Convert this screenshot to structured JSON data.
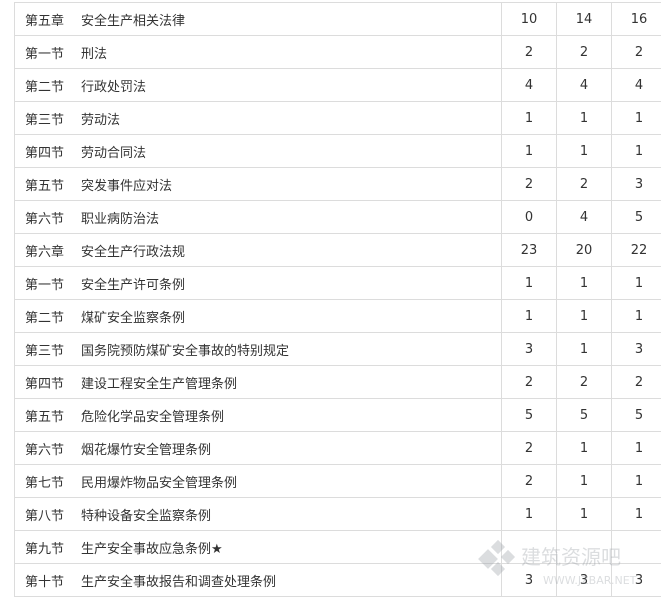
{
  "rows": [
    {
      "section": "第五章",
      "title": "安全生产相关法律",
      "counts": [
        "10",
        "14",
        "16"
      ]
    },
    {
      "section": "第一节",
      "title": "刑法",
      "counts": [
        "2",
        "2",
        "2"
      ]
    },
    {
      "section": "第二节",
      "title": "行政处罚法",
      "counts": [
        "4",
        "4",
        "4"
      ]
    },
    {
      "section": "第三节",
      "title": "劳动法",
      "counts": [
        "1",
        "1",
        "1"
      ]
    },
    {
      "section": "第四节",
      "title": "劳动合同法",
      "counts": [
        "1",
        "1",
        "1"
      ]
    },
    {
      "section": "第五节",
      "title": "突发事件应对法",
      "counts": [
        "2",
        "2",
        "3"
      ]
    },
    {
      "section": "第六节",
      "title": "职业病防治法",
      "counts": [
        "0",
        "4",
        "5"
      ]
    },
    {
      "section": "第六章",
      "title": "安全生产行政法规",
      "counts": [
        "23",
        "20",
        "22"
      ]
    },
    {
      "section": "第一节",
      "title": "安全生产许可条例",
      "counts": [
        "1",
        "1",
        "1"
      ]
    },
    {
      "section": "第二节",
      "title": "煤矿安全监察条例",
      "counts": [
        "1",
        "1",
        "1"
      ]
    },
    {
      "section": "第三节",
      "title": "国务院预防煤矿安全事故的特别规定",
      "counts": [
        "3",
        "1",
        "3"
      ]
    },
    {
      "section": "第四节",
      "title": "建设工程安全生产管理条例",
      "counts": [
        "2",
        "2",
        "2"
      ]
    },
    {
      "section": "第五节",
      "title": "危险化学品安全管理条例",
      "counts": [
        "5",
        "5",
        "5"
      ]
    },
    {
      "section": "第六节",
      "title": "烟花爆竹安全管理条例",
      "counts": [
        "2",
        "1",
        "1"
      ]
    },
    {
      "section": "第七节",
      "title": "民用爆炸物品安全管理条例",
      "counts": [
        "2",
        "1",
        "1"
      ]
    },
    {
      "section": "第八节",
      "title": "特种设备安全监察条例",
      "counts": [
        "1",
        "1",
        "1"
      ]
    },
    {
      "section": "第九节",
      "title": "生产安全事故应急条例★",
      "counts": [
        "",
        "",
        ""
      ]
    },
    {
      "section": "第十节",
      "title": "生产安全事故报告和调查处理条例",
      "counts": [
        "3",
        "3",
        "3"
      ]
    }
  ],
  "watermark": {
    "text": "建筑资源吧",
    "url": "WWW.JZBAR.NET",
    "color": "#9aa0a6",
    "icon": "logo-diamond-icon"
  }
}
